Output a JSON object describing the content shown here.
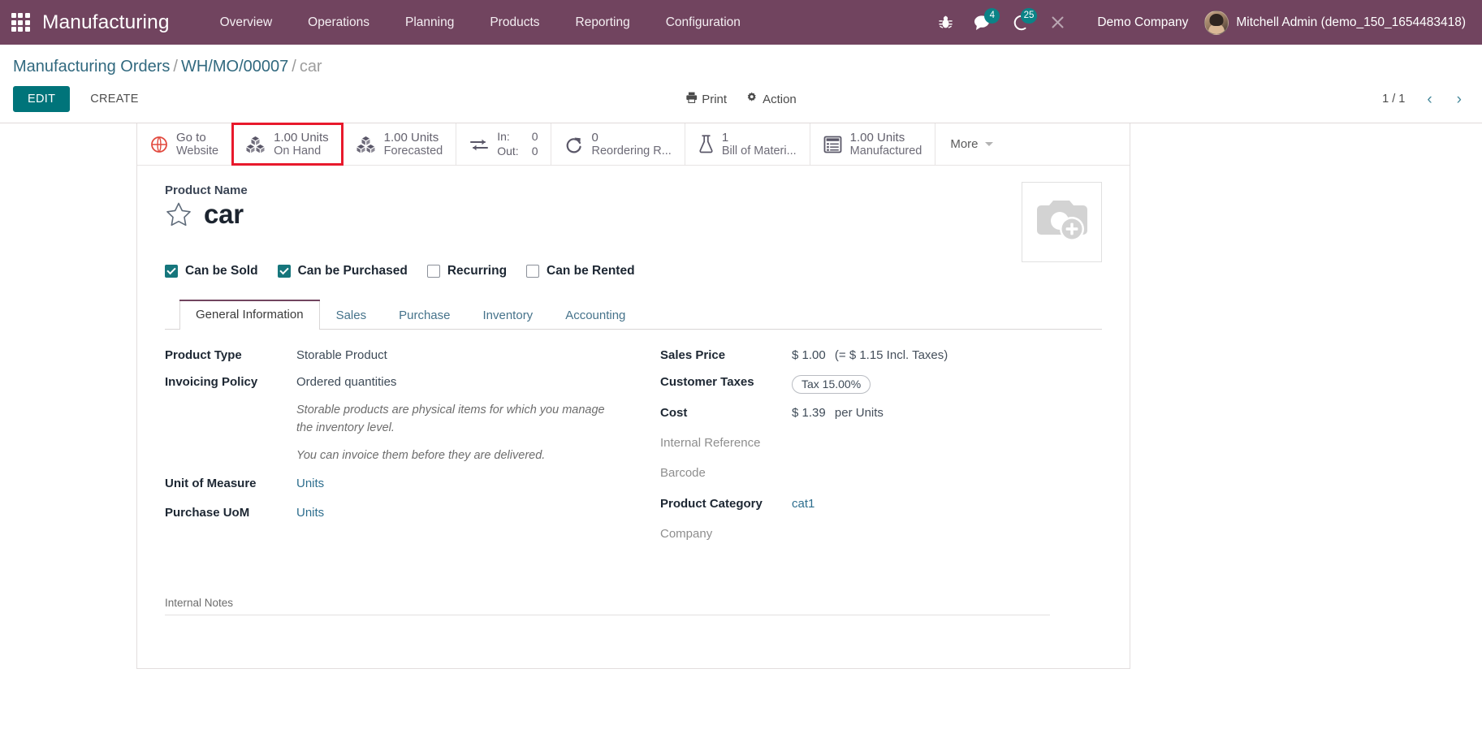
{
  "navbar": {
    "apps_icon": "apps-grid-icon",
    "app_title": "Manufacturing",
    "menu": [
      {
        "label": "Overview"
      },
      {
        "label": "Operations"
      },
      {
        "label": "Planning"
      },
      {
        "label": "Products"
      },
      {
        "label": "Reporting"
      },
      {
        "label": "Configuration"
      }
    ],
    "icons": {
      "debug": "bug-icon",
      "messages": "chat-bubble-icon",
      "messages_count": "4",
      "activities": "clock-moon-icon",
      "activities_count": "25",
      "shortcut": "scissors-icon"
    },
    "company": "Demo Company",
    "user": "Mitchell Admin (demo_150_1654483418)",
    "brand_color": "#71445f",
    "badge_color": "#0b8387"
  },
  "control_panel": {
    "breadcrumb": {
      "root": "Manufacturing Orders",
      "sep": "/",
      "order": "WH/MO/00007",
      "current": "car"
    },
    "edit_label": "EDIT",
    "create_label": "CREATE",
    "print_label": "Print",
    "action_label": "Action",
    "pager": "1 / 1",
    "prev_icon": "chevron-left-icon",
    "next_icon": "chevron-right-icon"
  },
  "stat_buttons": [
    {
      "name": "go-to-website",
      "icon": "globe-icon",
      "value": "",
      "label1": "Go to",
      "label2": "Website",
      "type": "two-line-label",
      "highlighted": false
    },
    {
      "name": "on-hand",
      "icon": "cubes-icon",
      "value": "1.00 Units",
      "label1": "On Hand",
      "type": "value-label",
      "highlighted": true
    },
    {
      "name": "forecasted",
      "icon": "cubes-icon",
      "value": "1.00 Units",
      "label1": "Forecasted",
      "type": "value-label",
      "highlighted": false
    },
    {
      "name": "in-out",
      "icon": "exchange-icon",
      "type": "kv",
      "k1": "In:",
      "v1": "0",
      "k2": "Out:",
      "v2": "0",
      "highlighted": false
    },
    {
      "name": "reordering-rules",
      "icon": "refresh-icon",
      "value": "0",
      "label1": "Reordering R...",
      "type": "value-label",
      "highlighted": false
    },
    {
      "name": "bill-of-materials",
      "icon": "flask-icon",
      "value": "1",
      "label1": "Bill of Materi...",
      "type": "value-label",
      "highlighted": false
    },
    {
      "name": "manufactured",
      "icon": "list-icon",
      "value": "1.00 Units",
      "label1": "Manufactured",
      "type": "value-label",
      "highlighted": false
    }
  ],
  "stat_more_label": "More",
  "form": {
    "product_name_label": "Product Name",
    "product_name": "car",
    "star_icon": "star-outline-icon",
    "image_placeholder_icon": "camera-add-icon",
    "checkboxes": [
      {
        "label": "Can be Sold",
        "checked": true
      },
      {
        "label": "Can be Purchased",
        "checked": true
      },
      {
        "label": "Recurring",
        "checked": false
      },
      {
        "label": "Can be Rented",
        "checked": false
      }
    ],
    "tabs": [
      {
        "label": "General Information",
        "active": true
      },
      {
        "label": "Sales",
        "active": false
      },
      {
        "label": "Purchase",
        "active": false
      },
      {
        "label": "Inventory",
        "active": false
      },
      {
        "label": "Accounting",
        "active": false
      }
    ],
    "left_fields": {
      "product_type_label": "Product Type",
      "product_type_value": "Storable Product",
      "invoicing_policy_label": "Invoicing Policy",
      "invoicing_policy_value": "Ordered quantities",
      "helper_1": "Storable products are physical items for which you manage the inventory level.",
      "helper_2": "You can invoice them before they are delivered.",
      "uom_label": "Unit of Measure",
      "uom_value": "Units",
      "purchase_uom_label": "Purchase UoM",
      "purchase_uom_value": "Units"
    },
    "right_fields": {
      "sales_price_label": "Sales Price",
      "sales_price_value": "$ 1.00",
      "sales_price_extra": "(= $ 1.15 Incl. Taxes)",
      "customer_taxes_label": "Customer Taxes",
      "customer_taxes_value": "Tax 15.00%",
      "cost_label": "Cost",
      "cost_value": "$ 1.39",
      "cost_extra": "per Units",
      "internal_reference_label": "Internal Reference",
      "internal_reference_value": "",
      "barcode_label": "Barcode",
      "barcode_value": "",
      "product_category_label": "Product Category",
      "product_category_value": "cat1",
      "company_label": "Company",
      "company_value": ""
    },
    "internal_notes_label": "Internal Notes"
  }
}
